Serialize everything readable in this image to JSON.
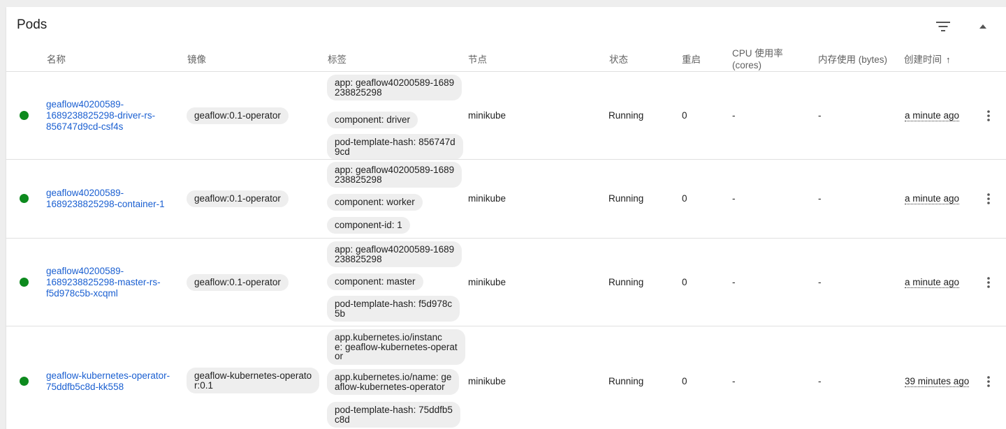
{
  "card": {
    "title": "Pods"
  },
  "icons": {
    "filter": "filter-list-icon",
    "collapse": "arrow-drop-up-icon",
    "more": "more-vert-icon",
    "sort": "arrow-upward-icon"
  },
  "colors": {
    "running": "#0d8a1e",
    "link": "#1a5fd1"
  },
  "columns": {
    "name": "名称",
    "image": "镜像",
    "labels": "标签",
    "node": "节点",
    "status": "状态",
    "restarts": "重启",
    "cpu_line1": "CPU 使用率",
    "cpu_line2": "(cores)",
    "memory": "内存使用 (bytes)",
    "created": "创建时间",
    "sort_arrow": "↑"
  },
  "rows": [
    {
      "name_lines": [
        "geaflow40200589-",
        "1689238825298-driver-rs-",
        "856747d9cd-csf4s"
      ],
      "image": "geaflow:0.1-operator",
      "labels": [
        [
          "app: geaflow40200589-1689",
          "238825298"
        ],
        [
          "component: driver"
        ],
        [
          "pod-template-hash: 856747d",
          "9cd"
        ]
      ],
      "node": "minikube",
      "status": "Running",
      "restarts": "0",
      "cpu": "-",
      "memory": "-",
      "created": "a minute ago"
    },
    {
      "name_lines": [
        "geaflow40200589-",
        "1689238825298-container-1"
      ],
      "image": "geaflow:0.1-operator",
      "labels": [
        [
          "app: geaflow40200589-1689",
          "238825298"
        ],
        [
          "component: worker"
        ],
        [
          "component-id: 1"
        ]
      ],
      "node": "minikube",
      "status": "Running",
      "restarts": "0",
      "cpu": "-",
      "memory": "-",
      "created": "a minute ago"
    },
    {
      "name_lines": [
        "geaflow40200589-",
        "1689238825298-master-rs-",
        "f5d978c5b-xcqml"
      ],
      "image": "geaflow:0.1-operator",
      "labels": [
        [
          "app: geaflow40200589-1689",
          "238825298"
        ],
        [
          "component: master"
        ],
        [
          "pod-template-hash: f5d978c",
          "5b"
        ]
      ],
      "node": "minikube",
      "status": "Running",
      "restarts": "0",
      "cpu": "-",
      "memory": "-",
      "created": "a minute ago"
    },
    {
      "name_lines": [
        "geaflow-kubernetes-operator-",
        "75ddfb5c8d-kk558"
      ],
      "image_lines": [
        "geaflow-kubernetes-operato",
        "r:0.1"
      ],
      "labels": [
        [
          "app.kubernetes.io/instanc",
          "e: geaflow-kubernetes-operat",
          "or"
        ],
        [
          "app.kubernetes.io/name: ge",
          "aflow-kubernetes-operator"
        ],
        [
          "pod-template-hash: 75ddfb5",
          "c8d"
        ]
      ],
      "node": "minikube",
      "status": "Running",
      "restarts": "0",
      "cpu": "-",
      "memory": "-",
      "created": "39 minutes ago"
    }
  ]
}
